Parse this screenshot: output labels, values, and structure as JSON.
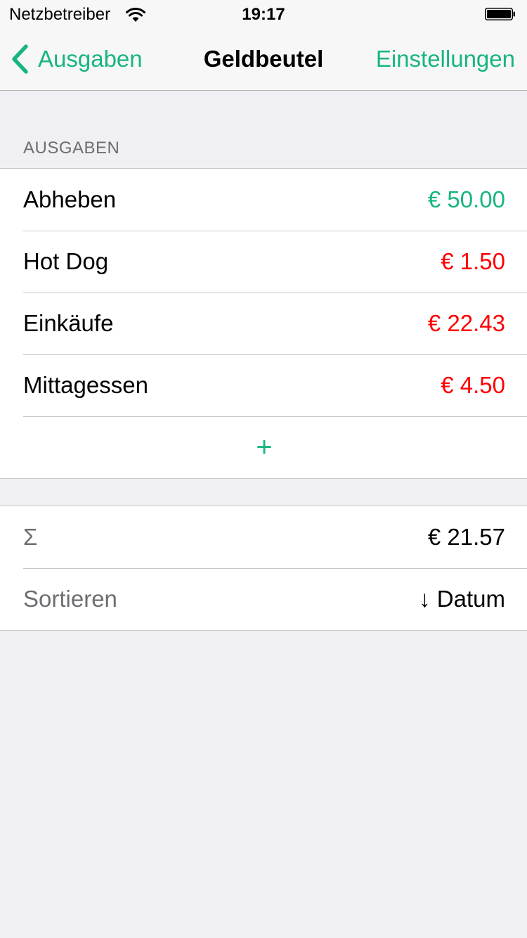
{
  "status_bar": {
    "carrier": "Netzbetreiber",
    "time": "19:17",
    "icons": [
      "wifi-icon",
      "battery-icon"
    ]
  },
  "nav": {
    "back_label": "Ausgaben",
    "title": "Geldbeutel",
    "right_label": "Einstellungen"
  },
  "colors": {
    "accent": "#18b581",
    "negative": "#ff0000",
    "muted": "#6d6d72",
    "background": "#efeff4"
  },
  "expenses": {
    "header": "AUSGABEN",
    "items": [
      {
        "label": "Abheben",
        "amount": "€ 50.00",
        "type": "positive"
      },
      {
        "label": "Hot Dog",
        "amount": "€ 1.50",
        "type": "negative"
      },
      {
        "label": "Einkäufe",
        "amount": "€ 22.43",
        "type": "negative"
      },
      {
        "label": "Mittagessen",
        "amount": "€ 4.50",
        "type": "negative"
      }
    ],
    "add_label": "+"
  },
  "summary": {
    "sum_label": "Σ",
    "sum_value": "€ 21.57",
    "sort_label": "Sortieren",
    "sort_value": "↓ Datum"
  }
}
